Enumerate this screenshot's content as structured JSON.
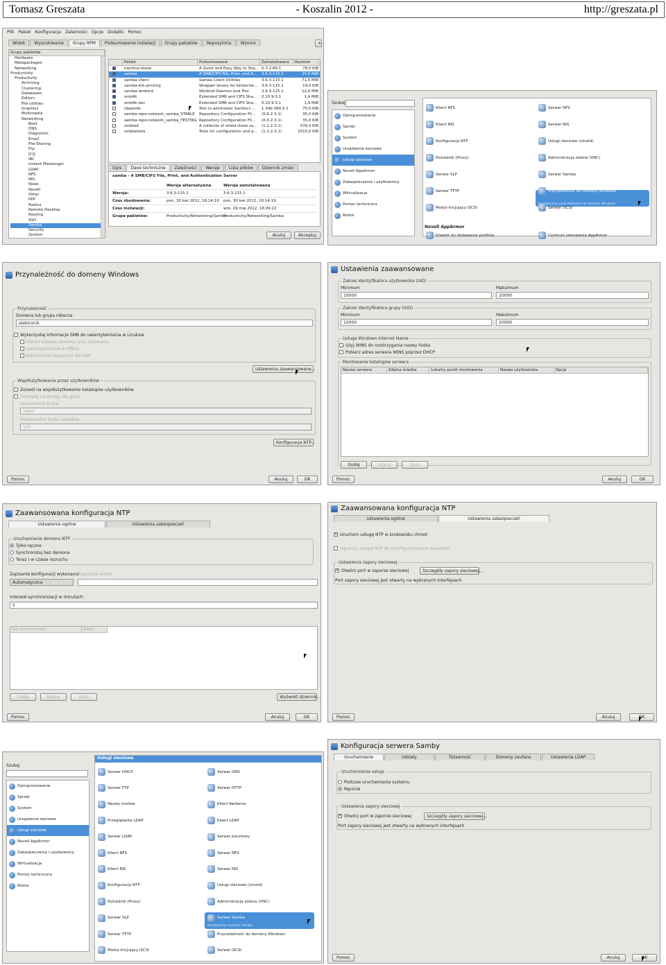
{
  "header": {
    "left": "Tomasz Greszata",
    "center": "- Koszalin 2012 -",
    "right": "http://greszata.pl"
  },
  "s1": {
    "menu": [
      "Plik",
      "Pakiet",
      "Konfiguracja",
      "Zależności",
      "Opcje",
      "Dodatki",
      "Pomoc"
    ],
    "tabs": [
      "Widok",
      "Wyszukiwanie",
      "Grupy RPM",
      "Podsumowanie instalacji",
      "Grupy pakietów",
      "Repozytoria",
      "Wzorce"
    ],
    "tree_header": "Grupy pakietów",
    "tree": [
      "Hardware",
      "Metapackages",
      "Networking",
      "Productivity",
      "Productivity",
      "Archiving",
      "Clustering",
      "Databases",
      "Editors",
      "File utilities",
      "Graphics",
      "Multimedia",
      "Networking",
      "Boot",
      "DNS",
      "Diagnostic",
      "Email",
      "File-Sharing",
      "Ftp",
      "ICQ",
      "IRC",
      "Instant Messenger",
      "LDAP",
      "NFS",
      "NIS",
      "News",
      "Novell",
      "Other",
      "PPP",
      "Radius",
      "Remote Desktop",
      "Routing",
      "SSH",
      "Samba",
      "Security",
      "System"
    ],
    "cols": [
      "Pakiet",
      "Podsumowanie",
      "Zainstalowano",
      "Rozmiar"
    ],
    "rows": [
      [
        "nautilus-share",
        "A Quick and Easy Way to Sha...",
        "0.7.2-89.1",
        "78,0 KiB"
      ],
      [
        "samba",
        "A SMB/CIFS File, Print, and A...",
        "3.6.3-115.1",
        "25,0 MiB"
      ],
      [
        "samba-client",
        "Samba Client Utilities",
        "3.6.3-115.1",
        "71,5 MiB"
      ],
      [
        "samba-krb-printing",
        "Wrapper binary for kerberize...",
        "3.6.3-115.1",
        "19,0 KiB"
      ],
      [
        "samba-winbind",
        "Winbind Daemon and Tool",
        "3.6.3-115.1",
        "12,6 MiB"
      ],
      [
        "smb4k",
        "Extended SMB and CIFS Sha...",
        "0.10.9-3.1",
        "1,4 MiB"
      ],
      [
        "smb4k-doc",
        "Extended SMB and CIFS Sha...",
        "0.10.9-3.1",
        "1,9 MiB"
      ],
      [
        "ldapsmb",
        "Tool to administer Samba's ...",
        "1.34b-360.5.1",
        "75,0 KiB"
      ],
      [
        "samba-repo-network_samba_STABLE",
        "Repository Configuration Fil...",
        "(0.6.2-3.1)",
        "35,0 KiB"
      ],
      [
        "samba-repo-network_samba_TESTING",
        "Repository Configuration Fil...",
        "(0.0.2-3.1)",
        "35,0 KiB"
      ],
      [
        "smbtad",
        "A collector of smbd share us...",
        "(1.2.2-3.1)",
        "576,0 KiB"
      ],
      [
        "smbtatools",
        "Tools for configuration and q...",
        "(1.2.2-3.1)",
        "1015,0 KiB"
      ]
    ],
    "checked": [
      true,
      true,
      true,
      true,
      true,
      true,
      true,
      false,
      false,
      false,
      false,
      false
    ],
    "bottom_tabs": [
      "Opis",
      "Dane techniczne",
      "Zależności",
      "Wersje",
      "Lista plików",
      "Dziennik zmian"
    ],
    "info_title": "samba - A SMB/CIFS File, Print, and Authentication Server",
    "info_head": [
      "Wersja alternatywna",
      "Wersja zainstalowana"
    ],
    "info_rows": [
      [
        "Wersja:",
        "3.6.3-115.1",
        "3.6.3-115.1"
      ],
      [
        "Czas zbudowania:",
        "pon, 30 kwi 2012, 18:14:19",
        "pon, 30 kwi 2012, 18:14:19"
      ],
      [
        "Czas instalacji:",
        "",
        "wto, 29 maj 2012, 18:09:22"
      ],
      [
        "Grupa pakietów:",
        "Productivity/Networking/Samba",
        "Productivity/Networking/Samba"
      ]
    ],
    "cancel": "Anuluj",
    "accept": "Akceptuj"
  },
  "s2": {
    "search_label": "Szukaj",
    "cats": [
      "Oprogramowanie",
      "Sprzęt",
      "System",
      "Urządzenia sieciowe",
      "Usługi sieciowe",
      "Novell AppArmor",
      "Zabezpieczenia i użytkownicy",
      "Wirtualizacja",
      "Pomoc techniczna",
      "Różne"
    ],
    "mods_left": [
      "Klient NFS",
      "Klient NIS",
      "Konfiguracja NTP",
      "Pośrednik (Proxy)",
      "Serwer SLP",
      "Serwer TFTP",
      "Moduł inicjujący iSCSI"
    ],
    "mods_right": [
      "Serwer NFS",
      "Serwer NIS",
      "Usługi sieciowe (xinetd)",
      "Administracja zdalna (VNC)",
      "Serwer Samba",
      "Przynależność do domeny Windows",
      "Serwer iSCSI"
    ],
    "selected_desc": "Konfiguracja przynależności do domeny Windows",
    "section": "Novell AppArmor",
    "apparmor": [
      "Kreator do dodawania profilów",
      "Centrum sterowania AppArmor"
    ]
  },
  "s3": {
    "title": "Przynależność do domeny Windows",
    "g1": "Przynależność",
    "domain_label": "Domena lub grupa robocza",
    "domain_value": "elektronik",
    "cb_smb": "Wykorzystaj informacje SMB do uwierzytelniania w Linuksie",
    "cb_sub": [
      "Utwórz katalog domowy przy logowaniu",
      "Uwierzytelnianie w offline",
      "Jednokrotne logowanie dla SSH"
    ],
    "adv_btn": "Ustawienia zaawansowane...",
    "g2": "Współużytkowanie przez użytkowników",
    "cb_share": "Zezwól na współużytkowanie katalogów użytkowników",
    "cb_guest": "Zezwalaj na dostęp dla gości",
    "grp_label": "Uprawniona grupa",
    "grp_value": "users",
    "max_label": "Maksymalna liczba udziałów",
    "max_value": "100",
    "ntp_btn": "Konfiguracja NTP...",
    "help": "Pomoc",
    "cancel": "Anuluj",
    "ok": "OK"
  },
  "s4": {
    "title": "Ustawienia zaawansowane",
    "g_uid": "Zakres identyfikatora użytkownika (UID)",
    "g_gid": "Zakres identyfikatora grupy (GID)",
    "min": "Minimum",
    "max": "Maksimum",
    "uid_min": "10000",
    "uid_max": "20000",
    "gid_min": "10000",
    "gid_max": "20000",
    "g_wins": "Usługa Windows Internet Name",
    "cb_wins1": "Użyj WINS do rozstrzygania nazwy hosta",
    "cb_wins2": "Pobierz adres serwera WINS poprzez DHCP",
    "g_mount": "Montowanie katalogów serwera",
    "cols": [
      "Nazwa serwera",
      "Zdalna ścieżka",
      "Lokalny punkt montowania",
      "Nazwa użytkownika",
      "Opcje"
    ],
    "add": "Dodaj",
    "edit": "Edytuj",
    "del": "Usuń",
    "help": "Pomoc",
    "cancel": "Anuluj",
    "ok": "OK"
  },
  "s5": {
    "title": "Zaawansowana konfiguracja NTP",
    "tabs": [
      "Ustawienia ogólne",
      "Ustawienia zabezpieczeń"
    ],
    "g_start": "Uruchamianie demona NTP",
    "radios": [
      "Tylko ręczne",
      "Synchronizuj bez demona",
      "Teraz i w czasie rozruchu"
    ],
    "store_label": "Zapisanie konfiguracji wykonania",
    "store_value": "Automatyczna",
    "store2_label": "Zapisanie ważne",
    "interval_label": "Interwał synchronizacji w minutach",
    "interval_value": "5",
    "cols": [
      "Typ synchronizacji",
      "Adres"
    ],
    "del": "Dodaj",
    "edit": "Edytuj",
    "remove": "Usuń",
    "log": "Wyświetl dziennik...",
    "help": "Pomoc",
    "cancel": "Anuluj",
    "ok": "OK"
  },
  "s6": {
    "title": "Zaawansowana konfiguracja NTP",
    "tabs": [
      "Ustawienia ogólne",
      "Ustawienia zabezpieczeń"
    ],
    "cb_chroot": "Uruchom usługę NTP w środowisku chroot",
    "cb_limit": "Ogranicz usługę NTP do skonfigurowanych serwerów",
    "g_fw": "Ustawienia zapory sieciowej",
    "cb_fw": "Otwórz port w zaporze sieciowej",
    "fw_btn": "Szczegóły zapory sieciowej...",
    "fw_note": "Port zapory sieciowej jest otwarty na wybranych interfejsach",
    "help": "Pomoc",
    "cancel": "Anuluj",
    "ok": "OK"
  },
  "s7": {
    "search_label": "Szukaj",
    "cats": [
      "Oprogramowanie",
      "Sprzęt",
      "System",
      "Urządzenia sieciowe",
      "Usługi sieciowe",
      "Novell AppArmor",
      "Zabezpieczenia i użytkownicy",
      "Wirtualizacja",
      "Pomoc techniczna",
      "Różne"
    ],
    "heading": "Usługi sieciowe",
    "mods_left": [
      "Serwer DHCP",
      "Serwer FTP",
      "Nazwy hostów",
      "Przeglądarka LDAP",
      "Serwer LDAP",
      "Klient NFS",
      "Klient NIS",
      "Konfiguracja NTP",
      "Pośrednik (Proxy)",
      "Serwer SLP",
      "Serwer TFTP",
      "Moduł inicjujący iSCSI"
    ],
    "mods_right": [
      "Serwer DNS",
      "Serwer HTTP",
      "Klient Kerberos",
      "Klient LDAP",
      "Serwer pocztowy",
      "Serwer NFS",
      "Serwer NIS",
      "Usługi sieciowe (xinetd)",
      "Administracja zdalna (VNC)",
      "Serwer Samba",
      "Przynależność do domeny Windows",
      "Serwer iSCSI"
    ],
    "selected_desc": "Konfiguracja serwera Samba"
  },
  "s8": {
    "title": "Konfiguracja serwera Samby",
    "tabs": [
      "Uruchamianie",
      "Udziały",
      "Tożsamość",
      "Domeny zaufane",
      "Ustawienia LDAP"
    ],
    "g_start": "Uruchomienie usługi",
    "radios": [
      "Podczas uruchamiania systemu",
      "Ręcznie"
    ],
    "g_fw": "Ustawienia zapory sieciowej",
    "cb_fw": "Otwórz port w zaporze sieciowej",
    "fw_btn": "Szczegóły zapory sieciowej...",
    "fw_note": "Port zapory sieciowej jest otwarty na wybranych interfejsach",
    "help": "Pomoc",
    "cancel": "Anuluj",
    "ok": "OK"
  }
}
